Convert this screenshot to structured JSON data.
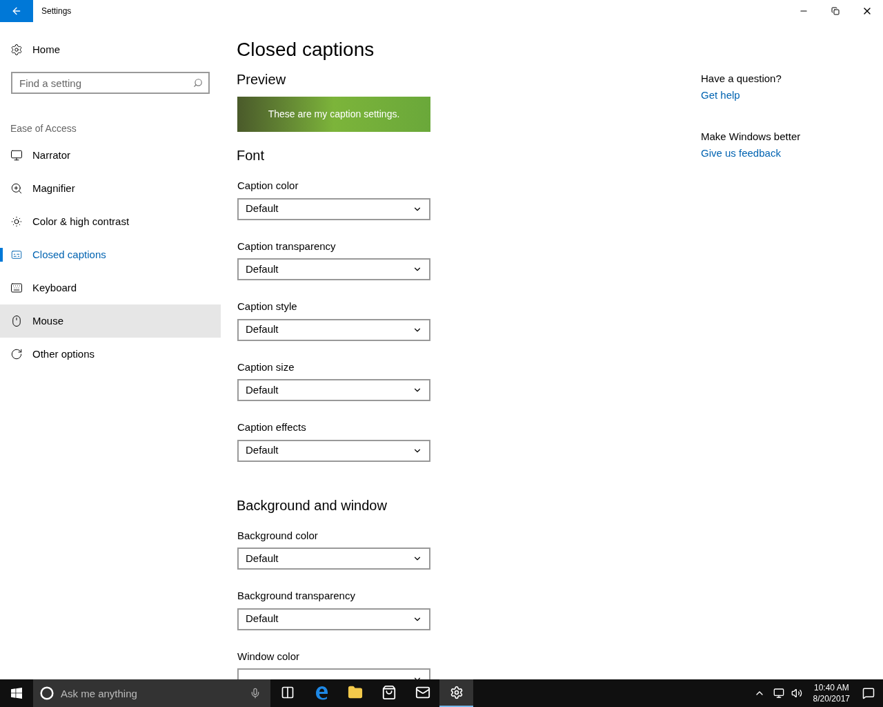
{
  "window": {
    "title": "Settings"
  },
  "sidebar": {
    "home": "Home",
    "search": {
      "placeholder": "Find a setting"
    },
    "section": "Ease of Access",
    "items": [
      {
        "label": "Narrator",
        "selected": false,
        "hovered": false
      },
      {
        "label": "Magnifier",
        "selected": false,
        "hovered": false
      },
      {
        "label": "Color & high contrast",
        "selected": false,
        "hovered": false
      },
      {
        "label": "Closed captions",
        "selected": true,
        "hovered": false
      },
      {
        "label": "Keyboard",
        "selected": false,
        "hovered": false
      },
      {
        "label": "Mouse",
        "selected": false,
        "hovered": true
      },
      {
        "label": "Other options",
        "selected": false,
        "hovered": false
      }
    ]
  },
  "main": {
    "title": "Closed captions",
    "preview": {
      "heading": "Preview",
      "caption": "These are my caption settings."
    },
    "sections": [
      {
        "heading": "Font",
        "fields": [
          {
            "label": "Caption color",
            "value": "Default"
          },
          {
            "label": "Caption transparency",
            "value": "Default"
          },
          {
            "label": "Caption style",
            "value": "Default"
          },
          {
            "label": "Caption size",
            "value": "Default"
          },
          {
            "label": "Caption effects",
            "value": "Default"
          }
        ]
      },
      {
        "heading": "Background and window",
        "fields": [
          {
            "label": "Background color",
            "value": "Default"
          },
          {
            "label": "Background transparency",
            "value": "Default"
          },
          {
            "label": "Window color"
          }
        ]
      }
    ]
  },
  "help": [
    {
      "heading": "Have a question?",
      "link": "Get help"
    },
    {
      "heading": "Make Windows better",
      "link": "Give us feedback"
    }
  ],
  "taskbar": {
    "search": {
      "placeholder": "Ask me anything"
    },
    "apps": [
      {
        "kind": "taskview",
        "active": false
      },
      {
        "kind": "edge",
        "active": false
      },
      {
        "kind": "explorer",
        "active": false
      },
      {
        "kind": "store",
        "active": false
      },
      {
        "kind": "mail",
        "active": false
      },
      {
        "kind": "settings",
        "active": true
      }
    ],
    "time": "10:40 AM",
    "date": "8/20/2017"
  }
}
